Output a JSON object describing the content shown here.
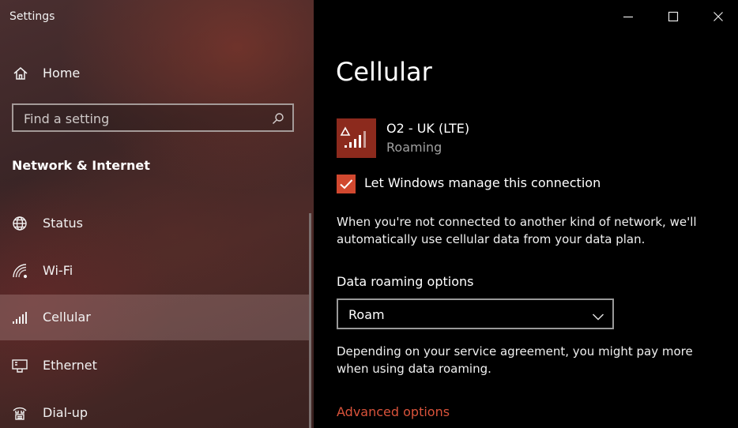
{
  "window": {
    "app_title": "Settings",
    "controls": {
      "minimize_icon": "minimize-icon",
      "maximize_icon": "maximize-icon",
      "close_icon": "close-icon"
    }
  },
  "sidebar": {
    "home": {
      "label": "Home",
      "icon": "home-icon"
    },
    "search": {
      "placeholder": "Find a setting",
      "icon": "search-icon"
    },
    "section_title": "Network & Internet",
    "items": [
      {
        "label": "Status",
        "icon": "globe-icon",
        "selected": false
      },
      {
        "label": "Wi-Fi",
        "icon": "wifi-icon",
        "selected": false
      },
      {
        "label": "Cellular",
        "icon": "cellular-signal-icon",
        "selected": true
      },
      {
        "label": "Ethernet",
        "icon": "ethernet-icon",
        "selected": false
      },
      {
        "label": "Dial-up",
        "icon": "dialup-icon",
        "selected": false
      }
    ]
  },
  "main": {
    "title": "Cellular",
    "network": {
      "name": "O2 - UK (LTE)",
      "status": "Roaming",
      "icon": "cellular-roaming-icon"
    },
    "manage_checkbox": {
      "label": "Let Windows manage this connection",
      "checked": true
    },
    "manage_description": "When you're not connected to another kind of network, we'll automatically use cellular data from your data plan.",
    "roaming": {
      "label": "Data roaming options",
      "selected": "Roam",
      "description": "Depending on your service agreement, you might pay more when using data roaming."
    },
    "advanced_link": "Advanced options"
  },
  "colors": {
    "accent": "#d1482f",
    "link": "#d9533b",
    "tile": "#8c2a1d",
    "main_bg": "#000000"
  }
}
